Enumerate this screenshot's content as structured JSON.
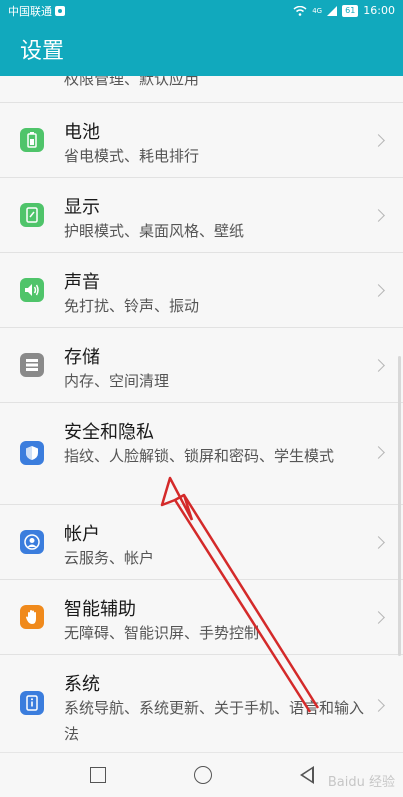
{
  "status_bar": {
    "carrier": "中国联通",
    "network": "4G",
    "battery": "61",
    "time": "16:00"
  },
  "header": {
    "title": "设置"
  },
  "items": [
    {
      "title": "",
      "subtitle": "权限管理、默认应用",
      "icon": "apps-icon",
      "color": "#3ca0e8"
    },
    {
      "title": "电池",
      "subtitle": "省电模式、耗电排行",
      "icon": "battery-icon",
      "color": "#4fc46a"
    },
    {
      "title": "显示",
      "subtitle": "护眼模式、桌面风格、壁纸",
      "icon": "display-icon",
      "color": "#4fc46a"
    },
    {
      "title": "声音",
      "subtitle": "免打扰、铃声、振动",
      "icon": "sound-icon",
      "color": "#4fc46a"
    },
    {
      "title": "存储",
      "subtitle": "内存、空间清理",
      "icon": "storage-icon",
      "color": "#8a8a8a"
    },
    {
      "title": "安全和隐私",
      "subtitle": "指纹、人脸解锁、锁屏和密码、学生模式",
      "icon": "shield-icon",
      "color": "#3b7ddd"
    },
    {
      "title": "帐户",
      "subtitle": "云服务、帐户",
      "icon": "account-icon",
      "color": "#3b7ddd"
    },
    {
      "title": "智能辅助",
      "subtitle": "无障碍、智能识屏、手势控制",
      "icon": "hand-icon",
      "color": "#f08a1c"
    },
    {
      "title": "系统",
      "subtitle": "系统导航、系统更新、关于手机、语言和输入法",
      "icon": "system-info-icon",
      "color": "#3b7ddd"
    }
  ],
  "watermark": "Baidu 经验",
  "colors": {
    "accent": "#11a9bd",
    "arrow": "#d42a2a"
  }
}
